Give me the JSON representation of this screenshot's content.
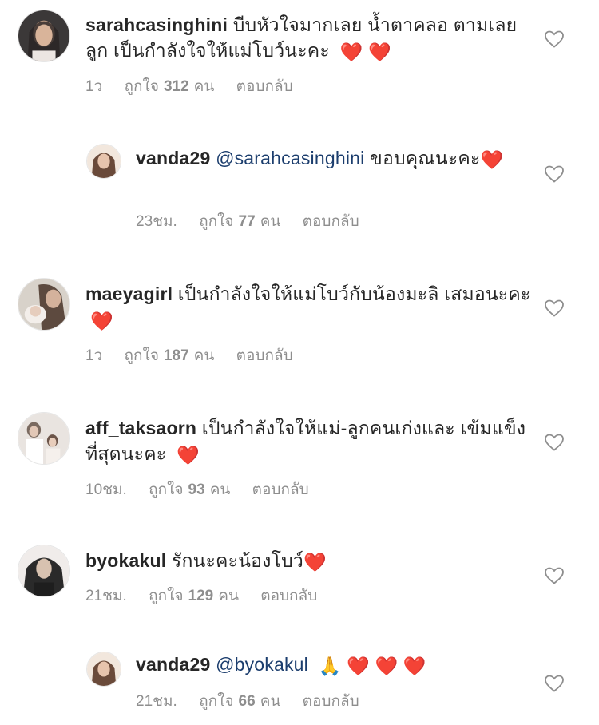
{
  "comments": [
    {
      "username": "sarahcasinghini",
      "text": "บีบหัวใจมากเลย น้ำตาคลอ ตามเลยลูก เป็นกำลังใจให้แม่โบว์นะคะ",
      "emoji": "❤️ ❤️",
      "time": "1ว",
      "likes_prefix": "ถูกใจ",
      "likes_count": "312",
      "likes_suffix": "คน",
      "reply_label": "ตอบกลับ",
      "avatar_colors": [
        "#3b3838",
        "#c9a48a"
      ]
    },
    {
      "username": "vanda29",
      "mention": "@sarahcasinghini",
      "text": "ขอบคุณนะคะ",
      "emoji": "❤️",
      "time": "23ชม.",
      "likes_prefix": "ถูกใจ",
      "likes_count": "77",
      "likes_suffix": "คน",
      "reply_label": "ตอบกลับ",
      "avatar_colors": [
        "#f2e7dd",
        "#6a4a3a"
      ]
    },
    {
      "username": "maeyagirl",
      "text": "เป็นกำลังใจให้แม่โบว์กับน้องมะลิ เสมอนะคะ",
      "emoji": "❤️",
      "time": "1ว",
      "likes_prefix": "ถูกใจ",
      "likes_count": "187",
      "likes_suffix": "คน",
      "reply_label": "ตอบกลับ",
      "avatar_colors": [
        "#d8d2ca",
        "#5d4a3f"
      ]
    },
    {
      "username": "aff_taksaorn",
      "text": "เป็นกำลังใจให้แม่-ลูกคนเก่งและ เข้มแข็งที่สุดนะคะ",
      "emoji": "❤️",
      "time": "10ชม.",
      "likes_prefix": "ถูกใจ",
      "likes_count": "93",
      "likes_suffix": "คน",
      "reply_label": "ตอบกลับ",
      "avatar_colors": [
        "#e9e4e0",
        "#7a6a60"
      ]
    },
    {
      "username": "byokakul",
      "text": "รักนะคะน้องโบว์",
      "emoji": "❤️",
      "time": "21ชม.",
      "likes_prefix": "ถูกใจ",
      "likes_count": "129",
      "likes_suffix": "คน",
      "reply_label": "ตอบกลับ",
      "avatar_colors": [
        "#2a2a2a",
        "#d8c2b0"
      ]
    },
    {
      "username": "vanda29",
      "mention": "@byokakul",
      "text": "",
      "emoji": "🙏 ❤️ ❤️ ❤️",
      "time": "21ชม.",
      "likes_prefix": "ถูกใจ",
      "likes_count": "66",
      "likes_suffix": "คน",
      "reply_label": "ตอบกลับ",
      "avatar_colors": [
        "#f2e7dd",
        "#6a4a3a"
      ]
    }
  ]
}
